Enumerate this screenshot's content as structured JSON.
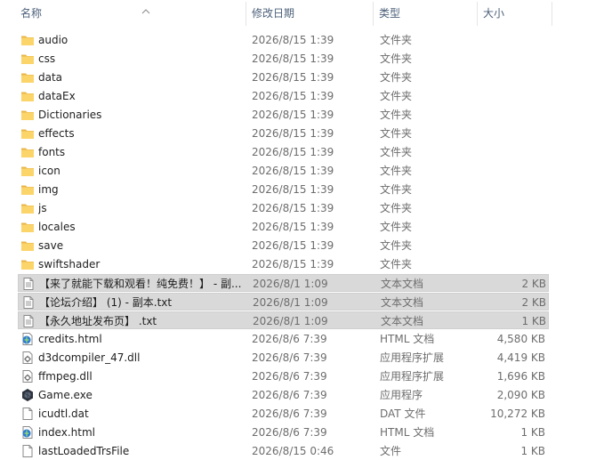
{
  "columns": {
    "name": "名称",
    "date": "修改日期",
    "type": "类型",
    "size": "大小"
  },
  "files": [
    {
      "name": "audio",
      "date": "2026/8/15 1:39",
      "type": "文件夹",
      "size": "",
      "icon": "folder-icon",
      "selected": false
    },
    {
      "name": "css",
      "date": "2026/8/15 1:39",
      "type": "文件夹",
      "size": "",
      "icon": "folder-icon",
      "selected": false
    },
    {
      "name": "data",
      "date": "2026/8/15 1:39",
      "type": "文件夹",
      "size": "",
      "icon": "folder-icon",
      "selected": false
    },
    {
      "name": "dataEx",
      "date": "2026/8/15 1:39",
      "type": "文件夹",
      "size": "",
      "icon": "folder-icon",
      "selected": false
    },
    {
      "name": "Dictionaries",
      "date": "2026/8/15 1:39",
      "type": "文件夹",
      "size": "",
      "icon": "folder-icon",
      "selected": false
    },
    {
      "name": "effects",
      "date": "2026/8/15 1:39",
      "type": "文件夹",
      "size": "",
      "icon": "folder-icon",
      "selected": false
    },
    {
      "name": "fonts",
      "date": "2026/8/15 1:39",
      "type": "文件夹",
      "size": "",
      "icon": "folder-icon",
      "selected": false
    },
    {
      "name": "icon",
      "date": "2026/8/15 1:39",
      "type": "文件夹",
      "size": "",
      "icon": "folder-icon",
      "selected": false
    },
    {
      "name": "img",
      "date": "2026/8/15 1:39",
      "type": "文件夹",
      "size": "",
      "icon": "folder-icon",
      "selected": false
    },
    {
      "name": "js",
      "date": "2026/8/15 1:39",
      "type": "文件夹",
      "size": "",
      "icon": "folder-icon",
      "selected": false
    },
    {
      "name": "locales",
      "date": "2026/8/15 1:39",
      "type": "文件夹",
      "size": "",
      "icon": "folder-icon",
      "selected": false
    },
    {
      "name": "save",
      "date": "2026/8/15 1:39",
      "type": "文件夹",
      "size": "",
      "icon": "folder-icon",
      "selected": false
    },
    {
      "name": "swiftshader",
      "date": "2026/8/15 1:39",
      "type": "文件夹",
      "size": "",
      "icon": "folder-icon",
      "selected": false
    },
    {
      "name": "【来了就能下载和观看！纯免费！】 - 副...",
      "date": "2026/8/1 1:09",
      "type": "文本文档",
      "size": "2 KB",
      "icon": "text-file-icon",
      "selected": true
    },
    {
      "name": "【论坛介绍】 (1) - 副本.txt",
      "date": "2026/8/1 1:09",
      "type": "文本文档",
      "size": "2 KB",
      "icon": "text-file-icon",
      "selected": true
    },
    {
      "name": "【永久地址发布页】 .txt",
      "date": "2026/8/1 1:09",
      "type": "文本文档",
      "size": "1 KB",
      "icon": "text-file-icon",
      "selected": true
    },
    {
      "name": "credits.html",
      "date": "2026/8/6 7:39",
      "type": "HTML 文档",
      "size": "4,580 KB",
      "icon": "html-file-icon",
      "selected": false
    },
    {
      "name": "d3dcompiler_47.dll",
      "date": "2026/8/6 7:39",
      "type": "应用程序扩展",
      "size": "4,419 KB",
      "icon": "dll-file-icon",
      "selected": false
    },
    {
      "name": "ffmpeg.dll",
      "date": "2026/8/6 7:39",
      "type": "应用程序扩展",
      "size": "1,696 KB",
      "icon": "dll-file-icon",
      "selected": false
    },
    {
      "name": "Game.exe",
      "date": "2026/8/6 7:39",
      "type": "应用程序",
      "size": "2,090 KB",
      "icon": "exe-file-icon",
      "selected": false
    },
    {
      "name": "icudtl.dat",
      "date": "2026/8/6 7:39",
      "type": "DAT 文件",
      "size": "10,272 KB",
      "icon": "blank-file-icon",
      "selected": false
    },
    {
      "name": "index.html",
      "date": "2026/8/6 7:39",
      "type": "HTML 文档",
      "size": "1 KB",
      "icon": "html-file-icon",
      "selected": false
    },
    {
      "name": "lastLoadedTrsFile",
      "date": "2026/8/15 0:46",
      "type": "文件",
      "size": "1 KB",
      "icon": "blank-file-icon",
      "selected": false
    }
  ]
}
